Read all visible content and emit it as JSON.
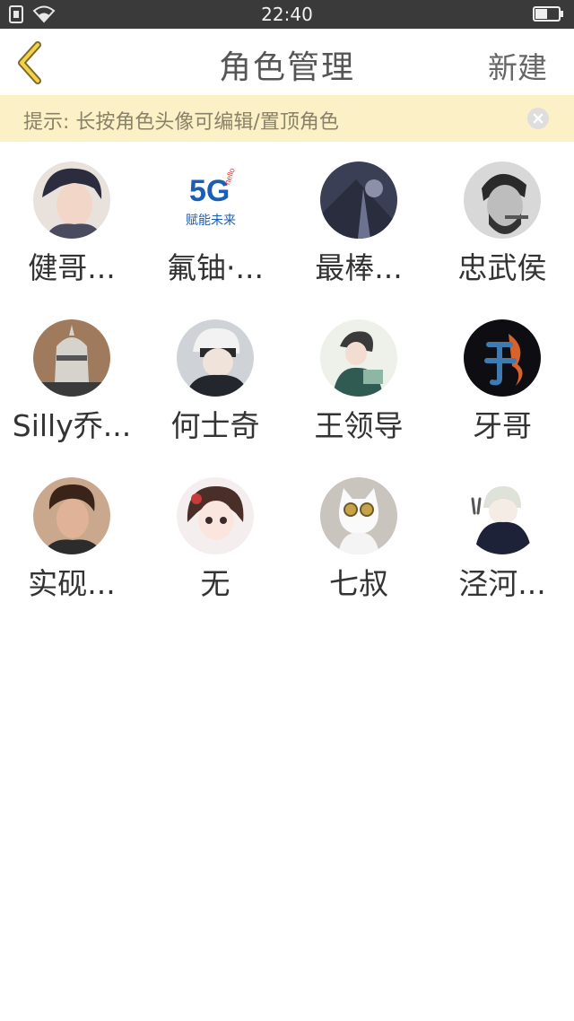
{
  "status_bar": {
    "time": "22:40",
    "icons": [
      "sim-icon",
      "wifi-icon",
      "battery-icon"
    ]
  },
  "header": {
    "back_icon": "chevron-left-icon",
    "title": "角色管理",
    "new_label": "新建"
  },
  "tip": {
    "text": "提示: 长按角色头像可编辑/置顶角色",
    "close_icon": "close-icon"
  },
  "roles": [
    {
      "name": "健哥..."
    },
    {
      "name": "氟铀·...",
      "avatar_text": "5G",
      "avatar_sub": "hello",
      "avatar_caption": "赋能未来"
    },
    {
      "name": "最棒..."
    },
    {
      "name": "忠武侯"
    },
    {
      "name": "Silly乔..."
    },
    {
      "name": "何士奇"
    },
    {
      "name": "王领导"
    },
    {
      "name": "牙哥"
    },
    {
      "name": "实砚..."
    },
    {
      "name": "无"
    },
    {
      "name": "七叔"
    },
    {
      "name": "泾河..."
    }
  ],
  "colors": {
    "status_bar": "#3a3a3a",
    "tip_background": "#fcf1c6",
    "back_icon": "#d9b74a"
  }
}
